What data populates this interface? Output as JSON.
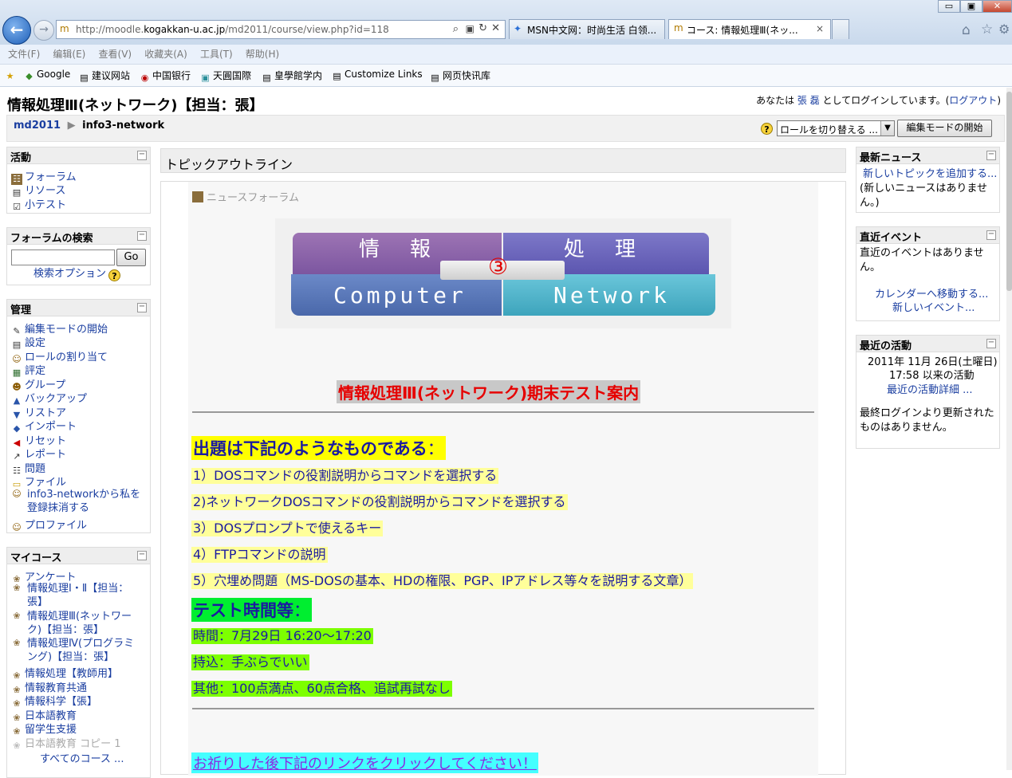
{
  "browser": {
    "url_prefix": "http://moodle.",
    "url_host": "kogakkan-u.ac.jp",
    "url_path": "/md2011/course/view.php?id=118",
    "tabs": [
      {
        "label": "MSN中文网：时尚生活 白领..."
      },
      {
        "label": "コース: 情報処理Ⅲ(ネッ...",
        "close": "×"
      }
    ],
    "window_buttons": [
      "▭",
      "▣",
      "✕"
    ],
    "menu": [
      "文件(F)",
      "编辑(E)",
      "查看(V)",
      "收藏夹(A)",
      "工具(T)",
      "帮助(H)"
    ],
    "favorites": [
      "Google",
      "建议网站",
      "中国银行",
      "天圓国際",
      "皇學館学内",
      "Customize Links",
      "网页快讯库"
    ]
  },
  "page": {
    "title": "情報処理Ⅲ(ネットワーク)【担当：張】",
    "login_prefix": "あなたは ",
    "login_user": "張 磊",
    "login_mid": " としてログインしています。(",
    "logout": "ログアウト",
    "login_suffix": ")",
    "breadcrumb": {
      "home": "md2011",
      "sep": "▶",
      "current": "info3-network"
    },
    "role_select": "ロールを切り替える ...",
    "edit_mode_button": "編集モードの開始"
  },
  "left": {
    "activities": {
      "title": "活動",
      "items": [
        "フォーラム",
        "リソース",
        "小テスト"
      ]
    },
    "forum_search": {
      "title": "フォーラムの検索",
      "go": "Go",
      "options": "検索オプション"
    },
    "admin": {
      "title": "管理",
      "items": [
        "編集モードの開始",
        "設定",
        "ロールの割り当て",
        "評定",
        "グループ",
        "バックアップ",
        "リストア",
        "インポート",
        "リセット",
        "レポート",
        "問題",
        "ファイル",
        "info3-networkから私を登録抹消する",
        "プロファイル"
      ]
    },
    "mycourses": {
      "title": "マイコース",
      "items": [
        "アンケート",
        "情報処理Ⅰ・Ⅱ【担当：張】",
        "情報処理Ⅲ(ネットワーク)【担当：張】",
        "情報処理Ⅳ(プログラミング)【担当：張】",
        "情報処理【教師用】",
        "情報教育共通",
        "情報科学【張】",
        "日本語教育",
        "留学生支援",
        "日本語教育 コピー 1"
      ],
      "all": "すべてのコース ..."
    }
  },
  "main": {
    "topic_outline": "トピックアウトライン",
    "news_forum": "ニュースフォーラム",
    "banner": {
      "top_left": "情　報",
      "top_right": "処　理",
      "num": "③",
      "bottom_left": "Computer",
      "bottom_right": "Network"
    },
    "exam_title": "情報処理Ⅲ(ネットワーク)期末テスト案内",
    "section1": "出題は下記のようなものである",
    "section1_colon": "：",
    "list": [
      "1）DOSコマンドの役割説明からコマンドを選択する",
      "2)ネットワークDOSコマンドの役割説明からコマンドを選択する",
      "3）DOSプロンプトで使えるキー",
      "4）FTPコマンドの説明",
      "5）穴埋め問題（MS-DOSの基本、HDの権限、PGP、IPアドレス等々を説明する文章）"
    ],
    "section2": "テスト時間等",
    "section2_colon": "：",
    "info": [
      "時間：7月29日 16:20～17:20",
      "持込：手ぶらでいい",
      "其他：100点満点、60点合格、追試再試なし"
    ],
    "footer_link": "お祈りした後下記のリンクをクリックしてください！"
  },
  "right": {
    "news": {
      "title": "最新ニュース",
      "add": "新しいトピックを追加する...",
      "none": "(新しいニュースはありません。)"
    },
    "events": {
      "title": "直近イベント",
      "none": "直近のイベントはありません。",
      "calendar": "カレンダーへ移動する...",
      "new_event": "新しいイベント..."
    },
    "recent": {
      "title": "最近の活動",
      "date": "2011年 11月 26日(土曜日)",
      "since": "17:58 以来の活動",
      "detail": "最近の活動詳細 ...",
      "none": "最終ログインより更新されたものはありません。"
    }
  },
  "colors": {
    "link": "#1a3ea0",
    "exam_title": "#e60000",
    "exam_title_bg": "#c8c8c8",
    "highlight_yellow": "#ffff9a",
    "highlight_green": "#7dff00",
    "footer_bg": "#4ff"
  }
}
